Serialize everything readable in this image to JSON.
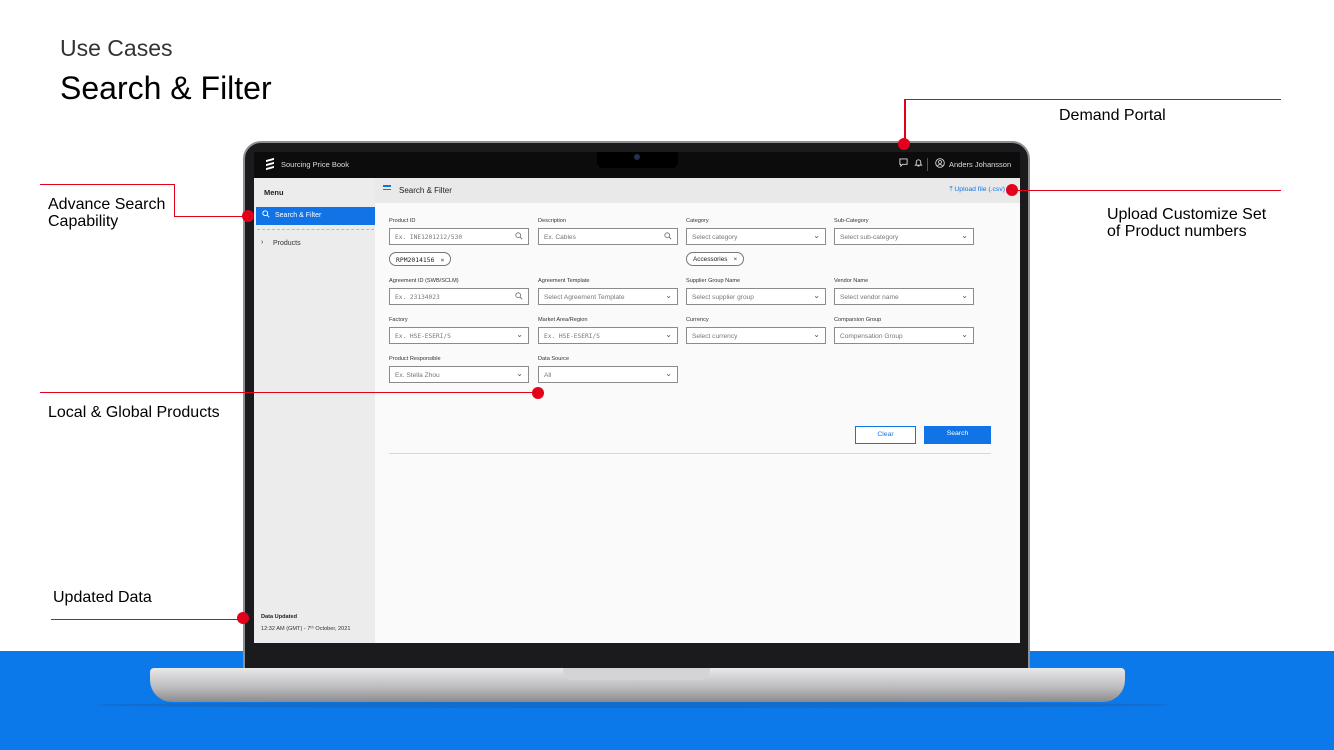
{
  "slide": {
    "kicker": "Use Cases",
    "title": "Search & Filter"
  },
  "annotations": {
    "demand_portal": "Demand Portal",
    "advance_search_line1": "Advance Search",
    "advance_search_line2": "Capability",
    "upload_line1": "Upload Customize Set",
    "upload_line2": "of Product numbers",
    "local_global": "Local & Global Products",
    "updated_data": "Updated Data"
  },
  "app": {
    "name": "Sourcing Price Book",
    "user": "Anders Johansson",
    "icons": [
      "chat-icon",
      "bell-icon",
      "user-icon"
    ]
  },
  "sidebar": {
    "menu_label": "Menu",
    "items": [
      {
        "label": "Search & Filter",
        "icon": "search-icon",
        "active": true
      },
      {
        "label": "Products",
        "icon": "chevron-right-icon",
        "active": false
      }
    ],
    "data_updated_title": "Data Updated",
    "data_updated_value": "12:32 AM (GMT) - 7ᵗʰ October, 2021"
  },
  "header": {
    "title": "Search & Filter",
    "upload_label": "Upload file (.csv)"
  },
  "form": {
    "product_id": {
      "label": "Product ID",
      "placeholder": "Ex. INE1201212/530"
    },
    "description": {
      "label": "Description",
      "placeholder": "Ex. Cables"
    },
    "category": {
      "label": "Category",
      "placeholder": "Select category"
    },
    "sub_category": {
      "label": "Sub-Category",
      "placeholder": "Select sub-category"
    },
    "product_chip": "RPM2014156",
    "category_chip": "Accessories",
    "agreement_id": {
      "label": "Agreement ID (SWB/SCLM)",
      "placeholder": "Ex. 23134023"
    },
    "agreement_template": {
      "label": "Agreement Template",
      "placeholder": "Select Agreement Template"
    },
    "supplier_group": {
      "label": "Supplier Group Name",
      "placeholder": "Select supplier group"
    },
    "vendor_name": {
      "label": "Vendor Name",
      "placeholder": "Select vendor name"
    },
    "factory": {
      "label": "Factory",
      "placeholder": "Ex. HSE-ESERI/S"
    },
    "market_area": {
      "label": "Market Area/Region",
      "placeholder": "Ex. HSE-ESERI/S"
    },
    "currency": {
      "label": "Currency",
      "placeholder": "Select currency"
    },
    "comparison_group": {
      "label": "Comparsion Group",
      "placeholder": "Compensation Group"
    },
    "product_responsible": {
      "label": "Product Responsible",
      "placeholder": "Ex. Stella Zhou"
    },
    "data_source": {
      "label": "Data Source",
      "value": "All"
    }
  },
  "buttons": {
    "clear": "Clear",
    "search": "Search"
  },
  "colors": {
    "accent": "#1174e6",
    "annotation": "#e3001b",
    "band": "#0b79ea"
  }
}
